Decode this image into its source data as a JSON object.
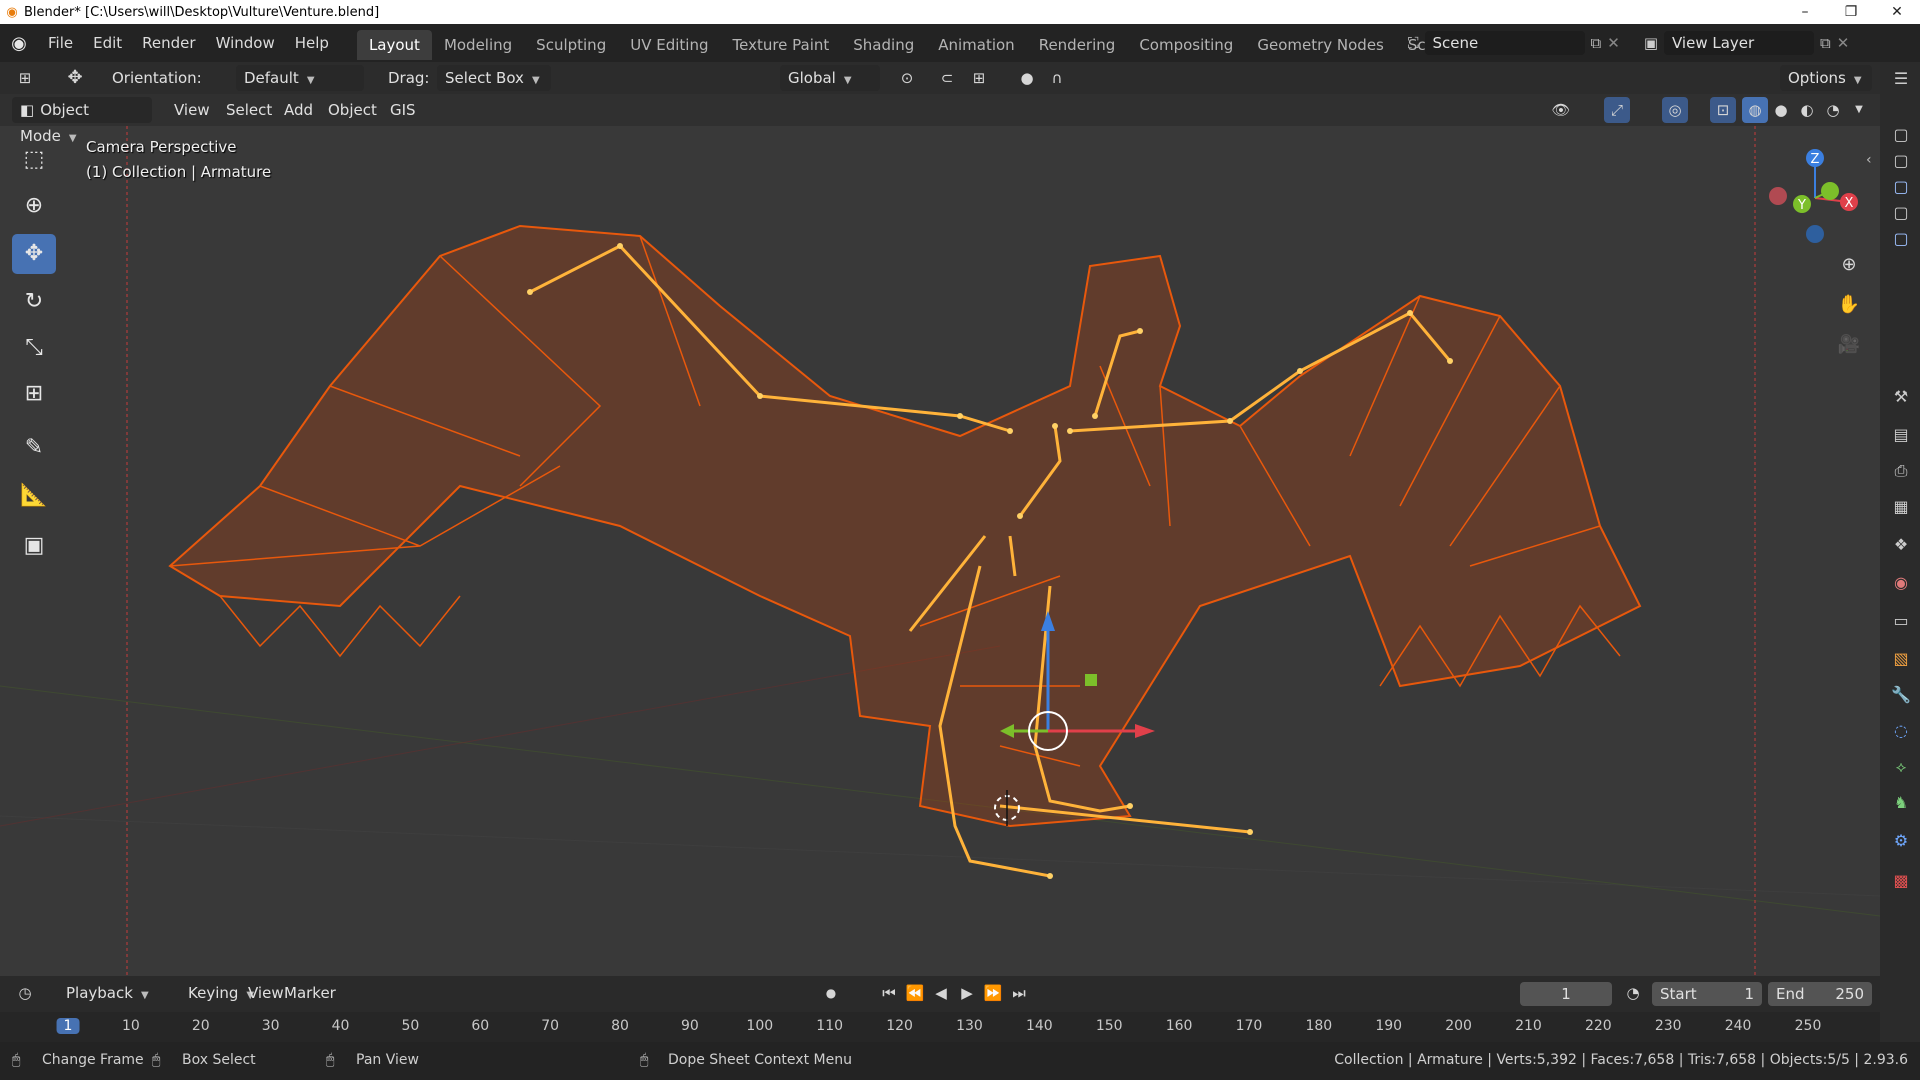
{
  "title": "Blender* [C:\\Users\\will\\Desktop\\Vulture\\Venture.blend]",
  "window_controls": [
    "–",
    "❐",
    "✕"
  ],
  "menu": [
    "File",
    "Edit",
    "Render",
    "Window",
    "Help"
  ],
  "workspaces": [
    "Layout",
    "Modeling",
    "Sculpting",
    "UV Editing",
    "Texture Paint",
    "Shading",
    "Animation",
    "Rendering",
    "Compositing",
    "Geometry Nodes",
    "Scripting"
  ],
  "active_workspace": "Layout",
  "scene": "Scene",
  "view_layer": "View Layer",
  "tool_header": {
    "orientation_label": "Orientation:",
    "orientation_value": "Default",
    "drag_label": "Drag:",
    "drag_value": "Select Box",
    "transform_orientation": "Global",
    "options": "Options"
  },
  "view_header": {
    "mode": "Object Mode",
    "menus": [
      "View",
      "Select",
      "Add",
      "Object",
      "GIS"
    ]
  },
  "viewport": {
    "camera_label": "Camera Perspective",
    "context_label": "(1) Collection | Armature"
  },
  "gizmo_axes": {
    "z": "Z",
    "y": "Y",
    "x": "X"
  },
  "timeline": {
    "menus": [
      "Playback",
      "Keying",
      "View",
      "Marker"
    ],
    "current_frame": "1",
    "start_label": "Start",
    "start": "1",
    "end_label": "End",
    "end": "250",
    "ticks": [
      "1",
      "10",
      "20",
      "30",
      "40",
      "50",
      "60",
      "70",
      "80",
      "90",
      "100",
      "110",
      "120",
      "130",
      "140",
      "150",
      "160",
      "170",
      "180",
      "190",
      "200",
      "210",
      "220",
      "230",
      "240",
      "250"
    ]
  },
  "status": {
    "hints": [
      "Change Frame",
      "Box Select",
      "Pan View",
      "Dope Sheet Context Menu"
    ],
    "stats": "Collection | Armature | Verts:5,392 | Faces:7,658 | Tris:7,658 | Objects:5/5 | 2.93.6"
  },
  "colors": {
    "accent": "#4772b3",
    "selection_orange": "#e8580c",
    "bone_color": "#ffb33a",
    "axis_x": "#e0404a",
    "axis_y": "#7cbf2a",
    "axis_z": "#3b7fe0"
  }
}
